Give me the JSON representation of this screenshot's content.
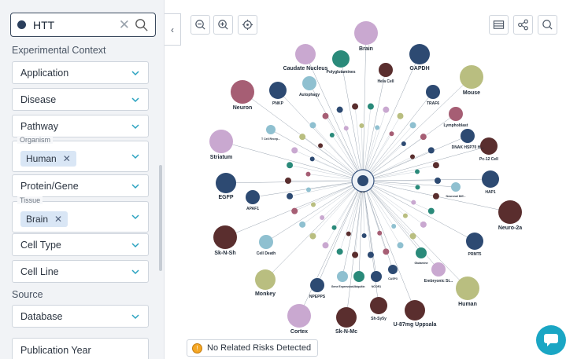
{
  "search": {
    "value": "HTT"
  },
  "filters": {
    "section_title": "Experimental Context",
    "application": "Application",
    "disease": "Disease",
    "pathway": "Pathway",
    "organism_legend": "Organism",
    "organism_chip": "Human",
    "protein": "Protein/Gene",
    "tissue_legend": "Tissue",
    "tissue_chip": "Brain",
    "cell_type": "Cell Type",
    "cell_line": "Cell Line",
    "source_title": "Source",
    "database": "Database",
    "publication_year": "Publication Year"
  },
  "status": {
    "text": "No Related Risks Detected"
  },
  "graph": {
    "center_label": "HTT",
    "nodes": [
      {
        "label": "Brain",
        "color": "#c9a8d0"
      },
      {
        "label": "GAPDH",
        "color": "#2d4a72"
      },
      {
        "label": "Caudate Nucleus",
        "color": "#c9a8d0"
      },
      {
        "label": "Polyglutamines",
        "color": "#2a8a7a"
      },
      {
        "label": "Mouse",
        "color": "#b9be80"
      },
      {
        "label": "Neuron",
        "color": "#a65e74"
      },
      {
        "label": "PNKP",
        "color": "#2d4a72"
      },
      {
        "label": "Autophagy",
        "color": "#8fc0d0"
      },
      {
        "label": "Hela Cell",
        "color": "#5a2e2e"
      },
      {
        "label": "TRAF6",
        "color": "#2d4a72"
      },
      {
        "label": "Lymphoblast",
        "color": "#a65e74"
      },
      {
        "label": "Striatum",
        "color": "#c9a8d0"
      },
      {
        "label": "Pc-12 Cell",
        "color": "#5a2e2e"
      },
      {
        "label": "DNAK HSP70 H...",
        "color": "#2d4a72"
      },
      {
        "label": "EGFP",
        "color": "#2d4a72"
      },
      {
        "label": "HAP1",
        "color": "#2d4a72"
      },
      {
        "label": "APAF1",
        "color": "#2d4a72"
      },
      {
        "label": "Neuro-2a",
        "color": "#5a2e2e"
      },
      {
        "label": "Sk-N-Sh",
        "color": "#5a2e2e"
      },
      {
        "label": "PRMT5",
        "color": "#2d4a72"
      },
      {
        "label": "Cell Death",
        "color": "#8fc0d0"
      },
      {
        "label": "Monkey",
        "color": "#b9be80"
      },
      {
        "label": "Human",
        "color": "#b9be80"
      },
      {
        "label": "Embryonic St...",
        "color": "#c9a8d0"
      },
      {
        "label": "NPEPPS",
        "color": "#2d4a72"
      },
      {
        "label": "Sh-Sy5y",
        "color": "#5a2e2e"
      },
      {
        "label": "U-87mg Uppsala",
        "color": "#5a2e2e"
      },
      {
        "label": "Cortex",
        "color": "#c9a8d0"
      },
      {
        "label": "Sk-N-Mc",
        "color": "#5a2e2e"
      },
      {
        "label": "T Cell Recep...",
        "color": "#8fc0d0"
      },
      {
        "label": "Gene Expression",
        "color": "#8fc0d0"
      },
      {
        "label": "Ubiquitin",
        "color": "#2a8a7a"
      },
      {
        "label": "NCOR1",
        "color": "#2d4a72"
      },
      {
        "label": "CASP3",
        "color": "#2d4a72"
      },
      {
        "label": "Glutamine",
        "color": "#2a8a7a"
      },
      {
        "label": "Neuronal Diff...",
        "color": "#8fc0d0"
      }
    ]
  }
}
